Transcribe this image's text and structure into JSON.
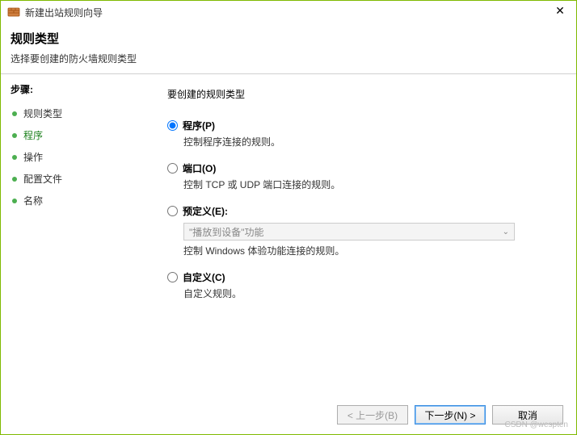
{
  "window": {
    "title": "新建出站规则向导",
    "close": "✕"
  },
  "header": {
    "title": "规则类型",
    "subtitle": "选择要创建的防火墙规则类型"
  },
  "sidebar": {
    "steps_label": "步骤:",
    "items": [
      {
        "label": "规则类型"
      },
      {
        "label": "程序"
      },
      {
        "label": "操作"
      },
      {
        "label": "配置文件"
      },
      {
        "label": "名称"
      }
    ]
  },
  "main": {
    "prompt": "要创建的规则类型",
    "options": [
      {
        "label": "程序(P)",
        "desc": "控制程序连接的规则。"
      },
      {
        "label": "端口(O)",
        "desc": "控制 TCP 或 UDP 端口连接的规则。"
      },
      {
        "label": "预定义(E):",
        "desc": "控制 Windows 体验功能连接的规则。"
      },
      {
        "label": "自定义(C)",
        "desc": "自定义规则。"
      }
    ],
    "predefined_dropdown": {
      "selected": "\"播放到设备\"功能"
    }
  },
  "footer": {
    "back": "< 上一步(B)",
    "next": "下一步(N) >",
    "cancel": "取消"
  },
  "watermark": "CSDN @wespten"
}
